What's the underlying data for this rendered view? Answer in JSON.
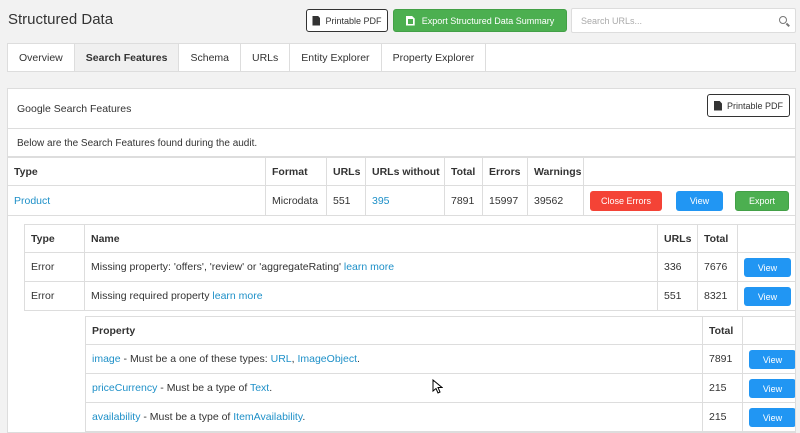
{
  "app": {
    "title": "Structured Data"
  },
  "header": {
    "printable_pdf": "Printable PDF",
    "export_summary": "Export Structured Data Summary",
    "search_placeholder": "Search URLs..."
  },
  "tabs": [
    {
      "label": "Overview"
    },
    {
      "label": "Search Features"
    },
    {
      "label": "Schema"
    },
    {
      "label": "URLs"
    },
    {
      "label": "Entity Explorer"
    },
    {
      "label": "Property Explorer"
    }
  ],
  "panel": {
    "title": "Google Search Features",
    "printable_pdf": "Printable PDF",
    "description": "Below are the Search Features found during the audit."
  },
  "main_table": {
    "headers": [
      "Type",
      "Format",
      "URLs",
      "URLs without",
      "Total",
      "Errors",
      "Warnings"
    ],
    "rows": [
      {
        "type": "Product",
        "format": "Microdata",
        "urls": "551",
        "urls_without": "395",
        "total": "7891",
        "errors": "15997",
        "warnings": "39562",
        "close_errors": "Close Errors",
        "view": "View",
        "export": "Export"
      }
    ]
  },
  "errors_table": {
    "headers": [
      "Type",
      "Name",
      "URLs",
      "Total"
    ],
    "rows": [
      {
        "type": "Error",
        "name": "Missing property: 'offers', 'review' or 'aggregateRating' ",
        "link": "learn more",
        "urls": "336",
        "total": "7676",
        "view": "View"
      },
      {
        "type": "Error",
        "name": "Missing required property ",
        "link": "learn more",
        "urls": "551",
        "total": "8321",
        "view": "View"
      }
    ]
  },
  "property_table": {
    "headers": [
      "Property",
      "Total"
    ],
    "rows": [
      {
        "prop": "image",
        "text": " - Must be a one of these types: ",
        "type1": "URL",
        "sep": ", ",
        "type2": "ImageObject",
        "end": ".",
        "total": "7891",
        "view": "View"
      },
      {
        "prop": "priceCurrency",
        "text": " - Must be a type of ",
        "type1": "Text",
        "end": ".",
        "total": "215",
        "view": "View"
      },
      {
        "prop": "availability",
        "text": " - Must be a type of ",
        "type1": "ItemAvailability",
        "end": ".",
        "total": "215",
        "view": "View"
      }
    ]
  },
  "colors": {
    "accent_blue": "#2196f3",
    "link": "#1e90c8",
    "green": "#4caf50",
    "red": "#f44336"
  }
}
